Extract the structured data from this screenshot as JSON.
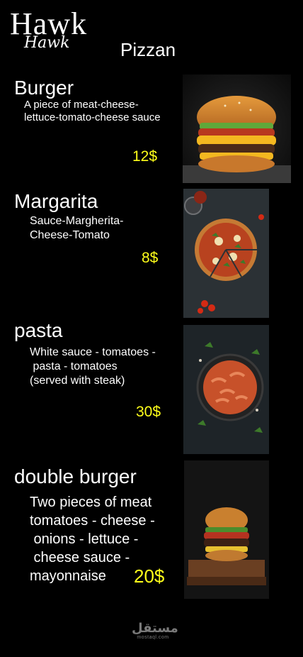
{
  "brand": {
    "logo_main": "Hawk",
    "logo_sub": "Hawk"
  },
  "restaurant_name": "Pizzan",
  "items": [
    {
      "name": "Burger",
      "desc_lines": [
        "A piece of meat-cheese-",
        "lettuce-tomato-cheese sauce"
      ],
      "price": "12$"
    },
    {
      "name": "Margarita",
      "desc_lines": [
        "Sauce-Margherita-",
        "Cheese-Tomato"
      ],
      "price": "8$"
    },
    {
      "name": "pasta",
      "desc_lines": [
        "White sauce - tomatoes -",
        " pasta - tomatoes",
        "(served with steak)"
      ],
      "price": "30$"
    },
    {
      "name": "double burger",
      "desc_lines": [
        "Two pieces of meat",
        "tomatoes - cheese -",
        " onions - lettuce -",
        " cheese sauce -",
        "mayonnaise"
      ],
      "price": "20$"
    }
  ],
  "footer": {
    "logo_arabic": "مستقل",
    "logo_latin": "mostaql.com"
  }
}
